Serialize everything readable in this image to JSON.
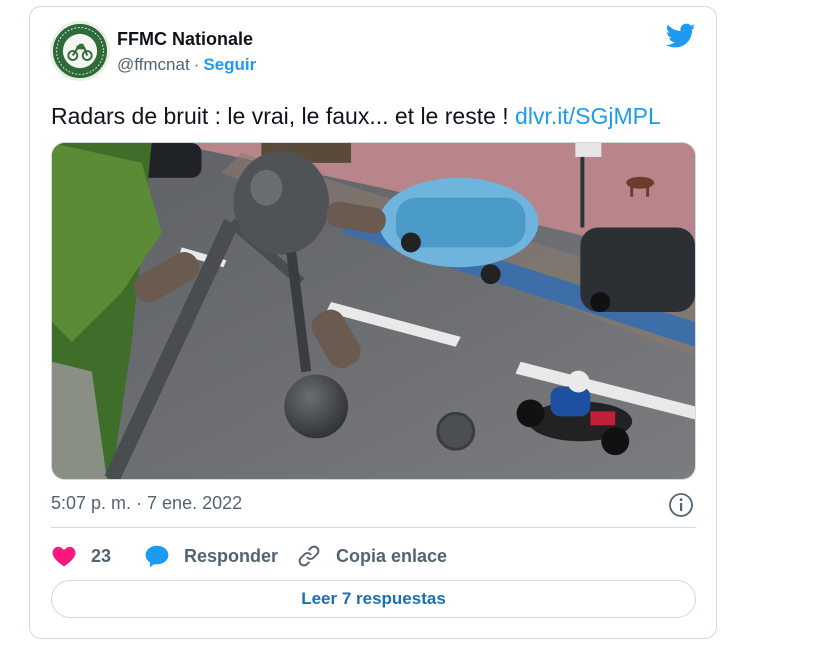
{
  "tweet": {
    "author_name": "FFMC Nationale",
    "handle": "@ffmcnat",
    "separator": "·",
    "follow_label": "Seguir",
    "text": "Radars de bruit : le vrai, le faux... et le reste ! ",
    "link_text": "dlvr.it/SGjMPL",
    "timestamp": "5:07 p. m. · 7 ene. 2022",
    "likes_count": "23",
    "reply_label": "Responder",
    "copy_link_label": "Copia enlace",
    "read_replies_label": "Leer 7 respuestas"
  },
  "icons": {
    "brand": "twitter-bird-icon",
    "like": "heart-icon",
    "reply": "speech-bubble-icon",
    "copy": "link-icon",
    "info": "info-icon"
  },
  "colors": {
    "accent": "#1d9bf0",
    "like": "#f91880",
    "text_secondary": "#536471",
    "border": "#cfd9de"
  }
}
